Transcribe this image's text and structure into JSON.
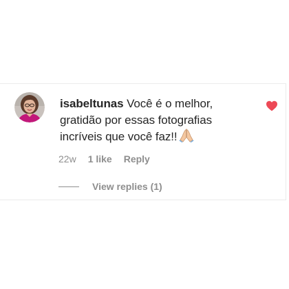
{
  "comment": {
    "username": "isabeltunas",
    "text": "Você é o melhor, gratidão por essas fotografias incríveis que você faz!!",
    "emoji_icon": "folded-hands-icon",
    "liked": true,
    "heart_color": "#ed4956"
  },
  "meta": {
    "time": "22w",
    "likes": "1 like",
    "reply_label": "Reply"
  },
  "replies": {
    "label": "View replies (1)"
  },
  "colors": {
    "text": "#262626",
    "secondary": "#8e8e8e",
    "border": "#ebebeb"
  }
}
